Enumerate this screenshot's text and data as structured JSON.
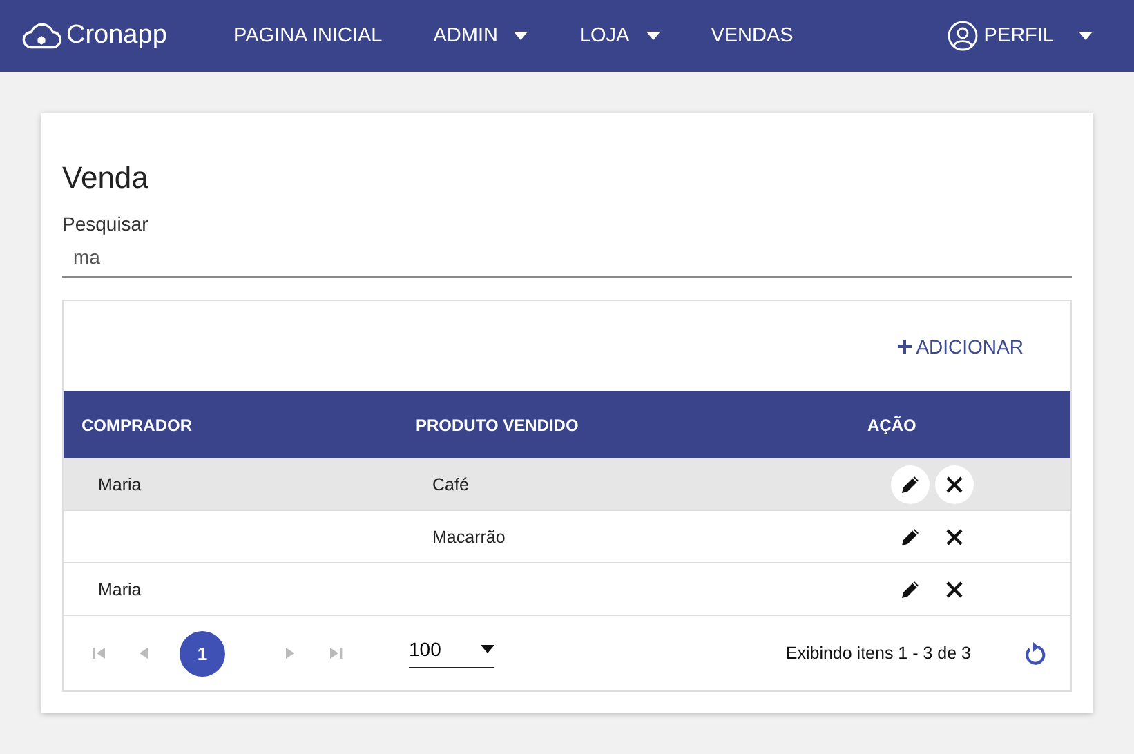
{
  "navbar": {
    "brand": "Cronapp",
    "items": [
      {
        "label": "PAGINA INICIAL",
        "dropdown": false
      },
      {
        "label": "ADMIN",
        "dropdown": true
      },
      {
        "label": "LOJA",
        "dropdown": true
      },
      {
        "label": "VENDAS",
        "dropdown": false
      }
    ],
    "profile": {
      "label": "PERFIL",
      "dropdown": true
    }
  },
  "page": {
    "title": "Venda",
    "search": {
      "label": "Pesquisar",
      "value": "ma"
    }
  },
  "grid": {
    "add_button": "ADICIONAR",
    "columns": [
      "COMPRADOR",
      "PRODUTO VENDIDO",
      "AÇÃO"
    ],
    "rows": [
      {
        "buyer": "Maria",
        "product": "Café",
        "selected": true
      },
      {
        "buyer": "",
        "product": "Macarrão",
        "selected": false
      },
      {
        "buyer": "Maria",
        "product": "",
        "selected": false
      }
    ],
    "pager": {
      "pages": [
        {
          "label": "1",
          "selected": true
        }
      ],
      "page_size": "100",
      "info": "Exibindo itens 1 - 3 de 3"
    }
  }
}
